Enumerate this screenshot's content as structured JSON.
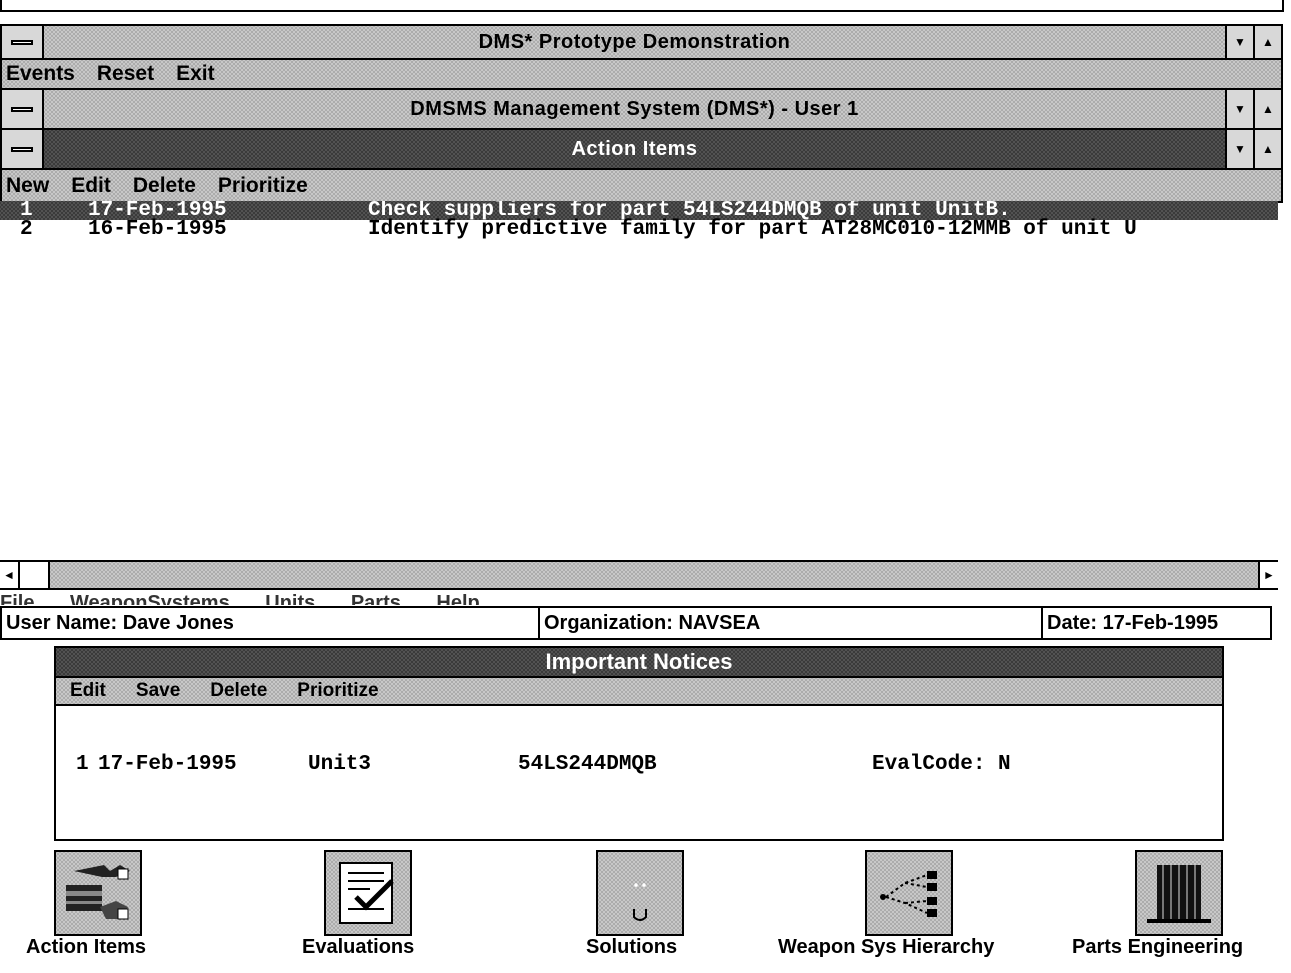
{
  "app_window": {
    "title": "DMS* Prototype Demonstration",
    "menu": [
      "Events",
      "Reset",
      "Exit"
    ]
  },
  "sub_window": {
    "title": "DMSMS Management System (DMS*) - User 1"
  },
  "action_items_window": {
    "title": "Action Items",
    "menu": [
      "New",
      "Edit",
      "Delete",
      "Prioritize"
    ],
    "rows": [
      {
        "num": "1",
        "date": "17-Feb-1995",
        "text": "Check suppliers for part 54LS244DMQB of unit UnitB.",
        "selected": true
      },
      {
        "num": "2",
        "date": "16-Feb-1995",
        "text": "Identify predictive family for part AT28MC010-12MMB of unit U",
        "selected": false
      }
    ]
  },
  "background_menu_ghost": [
    "File",
    "WeaponSystems",
    "Units",
    "Parts",
    "Help"
  ],
  "info_bar": {
    "user": "User Name: Dave Jones",
    "organization": "Organization: NAVSEA",
    "date": "Date: 17-Feb-1995"
  },
  "important_notices": {
    "title": "Important Notices",
    "menu": [
      "Edit",
      "Save",
      "Delete",
      "Prioritize"
    ],
    "rows": [
      {
        "num": "1",
        "date": "17-Feb-1995",
        "unit": "Unit3",
        "part": "54LS244DMQB",
        "eval": "EvalCode: N"
      }
    ]
  },
  "toolbar": {
    "action_items": "Action Items",
    "evaluations": "Evaluations",
    "solutions": "Solutions",
    "weapon_sys_hierarchy": "Weapon Sys Hierarchy",
    "parts_engineering": "Parts Engineering"
  },
  "colors": {
    "title_active": "#3a3a3a",
    "title_inactive": "#c8c8c8",
    "selection": "#000000"
  }
}
